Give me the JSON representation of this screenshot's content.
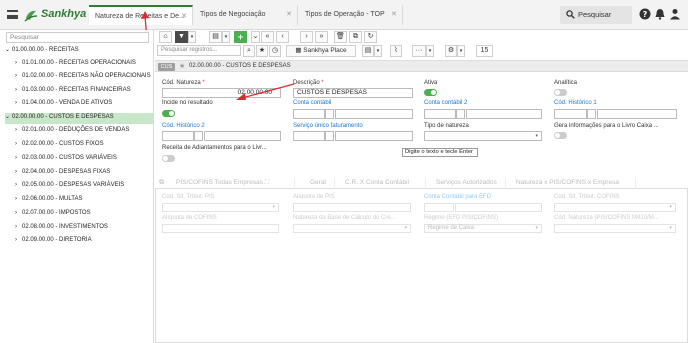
{
  "brand": {
    "name": "Sankhya",
    "color": "#2e7d32"
  },
  "tabs": [
    {
      "label": "Natureza de Receitas e De..."
    },
    {
      "label": "Tipos de Negociação"
    },
    {
      "label": "Tipos de Operação - TOP"
    }
  ],
  "top_search": {
    "label": "Pesquisar"
  },
  "sidebar": {
    "search_placeholder": "Pesquisar",
    "items": [
      {
        "label": "01.00.00.00 - RECEITAS"
      },
      {
        "label": "01.01.00.00 - RECEITAS OPERACIONAIS"
      },
      {
        "label": "01.02.00.00 - RECEITAS NÃO OPERACIONAIS"
      },
      {
        "label": "01.03.00.00 - RECEITAS FINANCEIRAS"
      },
      {
        "label": "01.04.00.00 - VENDA DE ATIVOS"
      },
      {
        "label": "02.00.00.00 - CUSTOS E DESPESAS"
      },
      {
        "label": "02.01.00.00 - DEDUÇÕES DE VENDAS"
      },
      {
        "label": "02.02.00.00 - CUSTOS FIXOS"
      },
      {
        "label": "02.03.00.00 - CUSTOS VARIÁVEIS"
      },
      {
        "label": "02.04.00.00 - DESPESAS FIXAS"
      },
      {
        "label": "02.05.00.00 - DESPESAS VARIÁVEIS"
      },
      {
        "label": "02.06.00.00 - MULTAS"
      },
      {
        "label": "02.07.00.00 - IMPOSTOS"
      },
      {
        "label": "02.08.00.00 - INVESTIMENTOS"
      },
      {
        "label": "02.09.00.00 - DIRETORIA"
      }
    ]
  },
  "toolbar": {
    "search_placeholder": "Pesquisar registros...",
    "place_label": "Sankhya Place",
    "page_size": "15"
  },
  "record": {
    "badge": "CUS",
    "title": "02.00.00.00 - CUSTOS E DESPESAS"
  },
  "form": {
    "cod_natureza_label": "Cód. Natureza",
    "cod_natureza_value": "02.00.00.00",
    "descricao_label": "Descrição",
    "descricao_value": "CUSTOS E DESPESAS",
    "ativa_label": "Ativa",
    "analitica_label": "Analítica",
    "incide_label": "Incide no resultado",
    "conta_contabil_label": "Conta contábil",
    "conta_contabil2_label": "Conta contábil 2",
    "cod_historico1_label": "Cód. Histórico 1",
    "cod_historico2_label": "Cód. Histórico 2",
    "servico_label": "Serviço único faturamento",
    "tipo_natureza_label": "Tipo de natureza",
    "gera_info_label": "Gera informações para o Livro Caixa ...",
    "receita_adiant_label": "Receita de Adiantamentos para o Livr...",
    "tooltip": "Digite o texto e tecle Enter"
  },
  "subtabs": [
    {
      "label": "PIS/COFINS Todas Empresas"
    },
    {
      "label": "Geral"
    },
    {
      "label": "C.R. X Conta Contábil"
    },
    {
      "label": "Serviços Autorizados"
    },
    {
      "label": "Natureza x PIS/COFINS x Empresa"
    }
  ],
  "piscofins": {
    "cst_pis_label": "Cod. Sit. Tribut. PIS",
    "aliq_pis_label": "Alíquota de PIS",
    "conta_efd_label": "Conta Contábil para EFD",
    "cst_cofins_label": "Cod. Sit. Tribut. COFINS",
    "aliq_cofins_label": "Alíquota de COFINS",
    "natureza_base_label": "Natureza da Base de Cálculo do Cré...",
    "regime_label": "Regime (EFD PIS/COFINS)",
    "regime_value": "Regime de Caixa",
    "cod_natureza_m_label": "Cód. Natureza (PIS/COFINS M410/M..."
  }
}
